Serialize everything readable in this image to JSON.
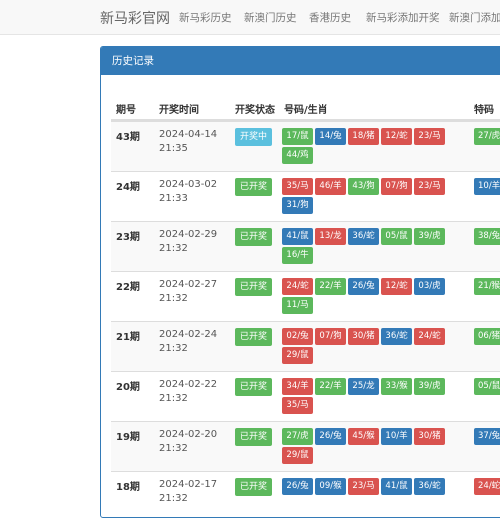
{
  "nav": {
    "brand": "新马彩官网",
    "links": [
      "新马彩历史",
      "新澳门历史",
      "香港历史",
      "新马彩添加开奖",
      "新澳门添加开"
    ]
  },
  "panel": {
    "title": "历史记录"
  },
  "table": {
    "headers": [
      "期号",
      "开奖时间",
      "开奖状态",
      "号码/生肖",
      "特码"
    ],
    "rows": [
      {
        "period": "43期",
        "time": "2024-04-14 21:35",
        "status": "开奖中",
        "status_kind": "open",
        "balls": [
          {
            "t": "17/鼠",
            "c": "green"
          },
          {
            "t": "14/兔",
            "c": "blue"
          },
          {
            "t": "18/猪",
            "c": "red"
          },
          {
            "t": "12/蛇",
            "c": "red"
          },
          {
            "t": "23/马",
            "c": "red"
          },
          {
            "t": "44/鸡",
            "c": "green"
          }
        ],
        "special": {
          "t": "27/虎",
          "c": "green"
        }
      },
      {
        "period": "24期",
        "time": "2024-03-02 21:33",
        "status": "已开奖",
        "status_kind": "done",
        "balls": [
          {
            "t": "35/马",
            "c": "red"
          },
          {
            "t": "46/羊",
            "c": "red"
          },
          {
            "t": "43/狗",
            "c": "green"
          },
          {
            "t": "07/狗",
            "c": "red"
          },
          {
            "t": "23/马",
            "c": "red"
          },
          {
            "t": "31/狗",
            "c": "blue"
          }
        ],
        "special": {
          "t": "10/羊",
          "c": "blue"
        }
      },
      {
        "period": "23期",
        "time": "2024-02-29 21:32",
        "status": "已开奖",
        "status_kind": "done",
        "balls": [
          {
            "t": "41/鼠",
            "c": "blue"
          },
          {
            "t": "13/龙",
            "c": "red"
          },
          {
            "t": "36/蛇",
            "c": "blue"
          },
          {
            "t": "05/鼠",
            "c": "green"
          },
          {
            "t": "39/虎",
            "c": "green"
          },
          {
            "t": "16/牛",
            "c": "green"
          }
        ],
        "special": {
          "t": "38/兔",
          "c": "green"
        }
      },
      {
        "period": "22期",
        "time": "2024-02-27 21:32",
        "status": "已开奖",
        "status_kind": "done",
        "balls": [
          {
            "t": "24/蛇",
            "c": "red"
          },
          {
            "t": "22/羊",
            "c": "green"
          },
          {
            "t": "26/兔",
            "c": "blue"
          },
          {
            "t": "12/蛇",
            "c": "red"
          },
          {
            "t": "03/虎",
            "c": "blue"
          },
          {
            "t": "11/马",
            "c": "green"
          }
        ],
        "special": {
          "t": "21/猴",
          "c": "green"
        }
      },
      {
        "period": "21期",
        "time": "2024-02-24 21:32",
        "status": "已开奖",
        "status_kind": "done",
        "balls": [
          {
            "t": "02/兔",
            "c": "red"
          },
          {
            "t": "07/狗",
            "c": "red"
          },
          {
            "t": "30/猪",
            "c": "red"
          },
          {
            "t": "36/蛇",
            "c": "blue"
          },
          {
            "t": "24/蛇",
            "c": "red"
          },
          {
            "t": "29/鼠",
            "c": "red"
          }
        ],
        "special": {
          "t": "06/猪",
          "c": "green"
        }
      },
      {
        "period": "20期",
        "time": "2024-02-22 21:32",
        "status": "已开奖",
        "status_kind": "done",
        "balls": [
          {
            "t": "34/羊",
            "c": "red"
          },
          {
            "t": "22/羊",
            "c": "green"
          },
          {
            "t": "25/龙",
            "c": "blue"
          },
          {
            "t": "33/猴",
            "c": "green"
          },
          {
            "t": "39/虎",
            "c": "green"
          },
          {
            "t": "35/马",
            "c": "red"
          }
        ],
        "special": {
          "t": "05/鼠",
          "c": "green"
        }
      },
      {
        "period": "19期",
        "time": "2024-02-20 21:32",
        "status": "已开奖",
        "status_kind": "done",
        "balls": [
          {
            "t": "27/虎",
            "c": "green"
          },
          {
            "t": "26/兔",
            "c": "blue"
          },
          {
            "t": "45/猴",
            "c": "red"
          },
          {
            "t": "10/羊",
            "c": "blue"
          },
          {
            "t": "30/猪",
            "c": "red"
          },
          {
            "t": "29/鼠",
            "c": "red"
          }
        ],
        "special": {
          "t": "37/兔",
          "c": "blue"
        }
      },
      {
        "period": "18期",
        "time": "2024-02-17 21:32",
        "status": "已开奖",
        "status_kind": "done",
        "balls": [
          {
            "t": "26/兔",
            "c": "blue"
          },
          {
            "t": "09/猴",
            "c": "blue"
          },
          {
            "t": "23/马",
            "c": "red"
          },
          {
            "t": "41/鼠",
            "c": "blue"
          },
          {
            "t": "36/蛇",
            "c": "blue"
          }
        ],
        "special": {
          "t": "24/蛇",
          "c": "red"
        }
      }
    ]
  }
}
